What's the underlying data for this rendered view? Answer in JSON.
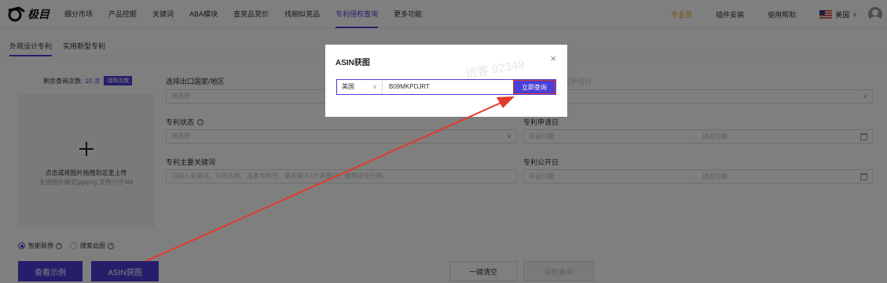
{
  "brand": {
    "logo_text": "极目"
  },
  "nav": {
    "items": [
      "细分市场",
      "产品挖掘",
      "关键词",
      "ABA模块",
      "查竞品竞价",
      "找相似竞品",
      "专利侵权查询",
      "更多功能"
    ],
    "active_index": 6,
    "vip": "专业员",
    "plugin": "插件安装",
    "help": "使用帮助",
    "country": "美国"
  },
  "subtabs": [
    "外观设计专利",
    "实用新型专利"
  ],
  "upload": {
    "remain_label": "剩余查询次数:",
    "remain_count": "10 次",
    "buy_label": "增购次数",
    "drop_main": "点击或将图片拖拽到这里上传",
    "drop_sub": "支持图片格式jpg/png,文件小于4M"
  },
  "options": {
    "smart": "智能联想",
    "search_img": "搜索此图"
  },
  "buttons": {
    "example": "查看示例",
    "asin": "ASIN获图",
    "clear": "一键清空",
    "infringe": "侵权查询"
  },
  "form": {
    "country_label": "选择出口国家/地区",
    "country_placeholder": "请选择",
    "apply_label": "专利申请日",
    "status_label": "专利状态",
    "status_placeholder": "请选择",
    "keyword_label": "专利主要关键词",
    "keyword_placeholder": "可输入关键词、公司名称、或者专利号，最多输入5个关键词，使用逗号分隔。",
    "publish_label": "专利公开日",
    "date_start": "开始日期",
    "date_sep": "→",
    "date_end": "结束日期"
  },
  "modal": {
    "title": "ASIN获图",
    "country": "美国",
    "asin": "B09MKPDJRT",
    "query": "立即查询",
    "watermark": "访客 92349"
  },
  "colors": {
    "accent": "#4a3fd6",
    "annotation": "#e23a2a",
    "vip": "#e5a800"
  }
}
